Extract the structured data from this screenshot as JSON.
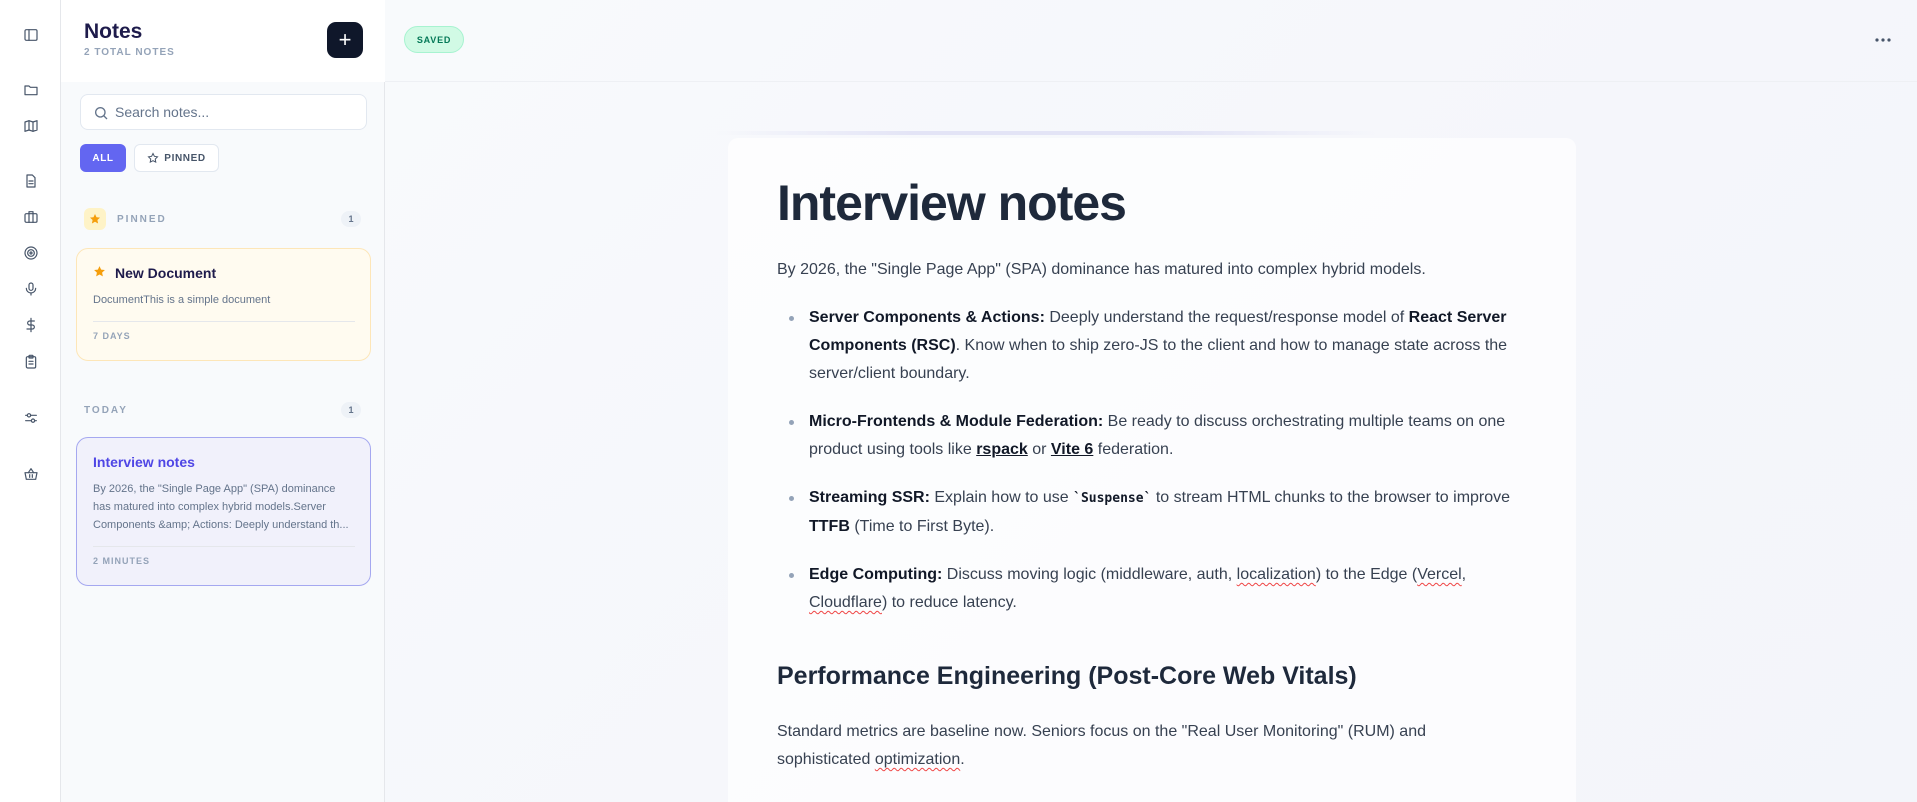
{
  "rail": {
    "icons": [
      "sidebar-toggle-icon",
      "folder-icon",
      "map-icon",
      "document-icon",
      "briefcase-icon",
      "target-icon",
      "microphone-icon",
      "dollar-icon",
      "clipboard-icon",
      "sliders-icon",
      "basket-icon"
    ]
  },
  "sidebar": {
    "title": "Notes",
    "count_label": "2 TOTAL NOTES",
    "add_label": "+",
    "search": {
      "placeholder": "Search notes..."
    },
    "filters": {
      "all": "ALL",
      "pinned": "PINNED"
    },
    "groups": [
      {
        "label": "PINNED",
        "count": "1",
        "notes": [
          {
            "title": "New Document",
            "excerpt": "DocumentThis is a simple document",
            "meta": "7 DAYS"
          }
        ]
      },
      {
        "label": "TODAY",
        "count": "1",
        "notes": [
          {
            "title": "Interview notes",
            "excerpt": "By 2026, the \"Single Page App\" (SPA) dominance has matured into complex hybrid models.Server Components &amp; Actions: Deeply understand th...",
            "meta": "2 MINUTES"
          }
        ]
      }
    ]
  },
  "topbar": {
    "status": "SAVED"
  },
  "document": {
    "title": "Interview notes",
    "intro": "By 2026, the \"Single Page App\" (SPA) dominance has matured into complex hybrid models.",
    "bullets": [
      {
        "term": "Server Components & Actions:",
        "t1": " Deeply understand the request/response model of ",
        "b1": "React Server Components (RSC)",
        "t2": ". Know when to ship zero-JS to the client and how to manage state across the server/client boundary."
      },
      {
        "term": "Micro-Frontends & Module Federation:",
        "t1": " Be ready to discuss orchestrating multiple teams on one product using tools like ",
        "b1": "rspack",
        "t2": " or ",
        "b2": "Vite 6",
        "t3": " federation."
      },
      {
        "term": "Streaming SSR:",
        "t1": " Explain how to use ",
        "code": "`Suspense`",
        "t2": " to stream HTML chunks to the browser to improve ",
        "b1": "TTFB",
        "t3": " (Time to First Byte)."
      },
      {
        "term": "Edge Computing:",
        "t1": " Discuss moving logic (middleware, auth, ",
        "w1": "localization",
        "t2": ") to the Edge (",
        "w2": "Vercel",
        "t3": ", ",
        "w3": "Cloudflare",
        "t4": ") to reduce latency."
      }
    ],
    "heading2": "Performance Engineering (Post-Core Web Vitals)",
    "para2_a": "Standard metrics are baseline now. Seniors focus on the \"Real User Monitoring\" (RUM) and sophisticated ",
    "para2_w": "optimization",
    "para2_b": "."
  },
  "colors": {
    "accent": "#6366f1",
    "pinned": "#f59e0b",
    "saved": "#047857"
  }
}
